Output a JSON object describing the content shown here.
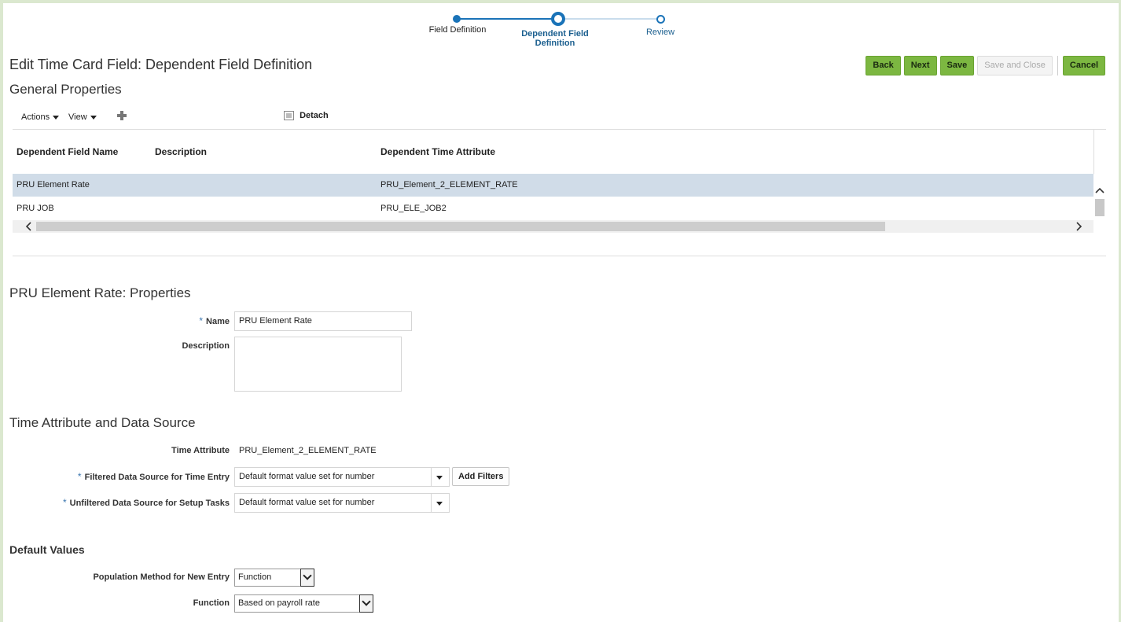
{
  "train": {
    "steps": [
      {
        "label": "Field Definition"
      },
      {
        "label": "Dependent Field Definition"
      },
      {
        "label": "Review"
      }
    ]
  },
  "page": {
    "title": "Edit Time Card Field: Dependent Field Definition"
  },
  "buttons": {
    "back": "Back",
    "next": "Next",
    "save": "Save",
    "save_close": "Save and Close",
    "cancel": "Cancel"
  },
  "general": {
    "title": "General Properties",
    "toolbar": {
      "actions": "Actions",
      "view": "View",
      "detach": "Detach"
    },
    "columns": [
      "Dependent Field Name",
      "Description",
      "Dependent Time Attribute"
    ],
    "rows": [
      {
        "name": "PRU Element Rate",
        "description": "",
        "attribute": "PRU_Element_2_ELEMENT_RATE"
      },
      {
        "name": "PRU JOB",
        "description": "",
        "attribute": "PRU_ELE_JOB2"
      }
    ]
  },
  "properties": {
    "title": "PRU Element Rate: Properties",
    "name_label": "Name",
    "name_value": "PRU Element Rate",
    "description_label": "Description",
    "description_value": ""
  },
  "time_attr": {
    "title": "Time Attribute and Data Source",
    "attr_label": "Time Attribute",
    "attr_value": "PRU_Element_2_ELEMENT_RATE",
    "filtered_label": "Filtered Data Source for Time Entry",
    "filtered_value": "Default format value set for number",
    "add_filters": "Add Filters",
    "unfiltered_label": "Unfiltered Data Source for Setup Tasks",
    "unfiltered_value": "Default format value set for number"
  },
  "defaults": {
    "title": "Default Values",
    "population_label": "Population Method for New Entry",
    "population_value": "Function",
    "function_label": "Function",
    "function_value": "Based on payroll rate"
  },
  "colors": {
    "accent_green": "#7cb741",
    "train_blue": "#1a73b8",
    "selected_row": "#d0dce8"
  }
}
